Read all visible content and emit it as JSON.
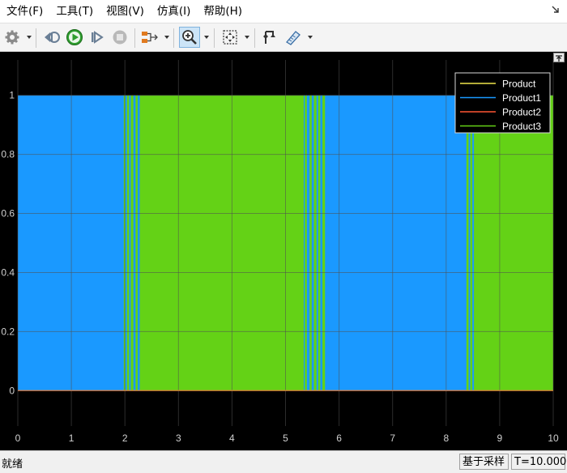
{
  "menu": {
    "items": [
      {
        "label": "文件(F)"
      },
      {
        "label": "工具(T)"
      },
      {
        "label": "视图(V)"
      },
      {
        "label": "仿真(I)"
      },
      {
        "label": "帮助(H)"
      }
    ]
  },
  "toolbar": {
    "icons": [
      "gear-icon",
      "step-back-icon",
      "run-icon",
      "step-forward-icon",
      "stop-icon",
      "signal-selector-icon",
      "zoom-in-icon",
      "fit-to-view-icon",
      "cursor-measure-icon",
      "highlight-block-icon"
    ]
  },
  "colors": {
    "plot_background": "#000000",
    "axes_background": "#000000",
    "grid": "#505050",
    "tick_text": "#d0d0d0",
    "zoom_active": "#cce4f7"
  },
  "chart_data": {
    "type": "line",
    "xlim": [
      0,
      10
    ],
    "ylim": [
      -0.12,
      1.12
    ],
    "x_ticks": [
      "0",
      "1",
      "2",
      "3",
      "4",
      "5",
      "6",
      "7",
      "8",
      "9",
      "10"
    ],
    "y_ticks": [
      "0",
      "0.2",
      "0.4",
      "0.6",
      "0.8",
      "1"
    ],
    "grid": true,
    "legend_position": "top-right",
    "series": [
      {
        "name": "Product",
        "color": "#f0e64a",
        "segments": [
          {
            "from": 0,
            "to": 10,
            "value": 0
          }
        ]
      },
      {
        "name": "Product1",
        "color": "#1a99ff",
        "segments": [
          {
            "from": 0,
            "to": 1.97,
            "value": 1
          },
          {
            "from": 5.73,
            "to": 8.37,
            "value": 1
          }
        ]
      },
      {
        "name": "Product2",
        "color": "#ff5533",
        "segments": [
          {
            "from": 0,
            "to": 10,
            "value": 0
          }
        ]
      },
      {
        "name": "Product3",
        "color": "#64d216",
        "segments": [
          {
            "from": 2.27,
            "to": 5.35,
            "value": 1
          },
          {
            "from": 8.55,
            "to": 10,
            "value": 1
          }
        ]
      }
    ],
    "transitions": [
      {
        "from": 1.97,
        "to": 2.27,
        "toggles": [
          1.97,
          2.0,
          2.03,
          2.07,
          2.1,
          2.15,
          2.19,
          2.23,
          2.27
        ]
      },
      {
        "from": 5.35,
        "to": 5.73,
        "toggles": [
          5.35,
          5.39,
          5.44,
          5.48,
          5.52,
          5.57,
          5.6,
          5.64,
          5.68,
          5.73
        ]
      },
      {
        "from": 8.37,
        "to": 8.55,
        "toggles": [
          8.37,
          8.41,
          8.44,
          8.48,
          8.51,
          8.55
        ]
      }
    ]
  },
  "status": {
    "ready": "就绪",
    "sample_mode": "基于采样",
    "time": "T=10.000"
  }
}
